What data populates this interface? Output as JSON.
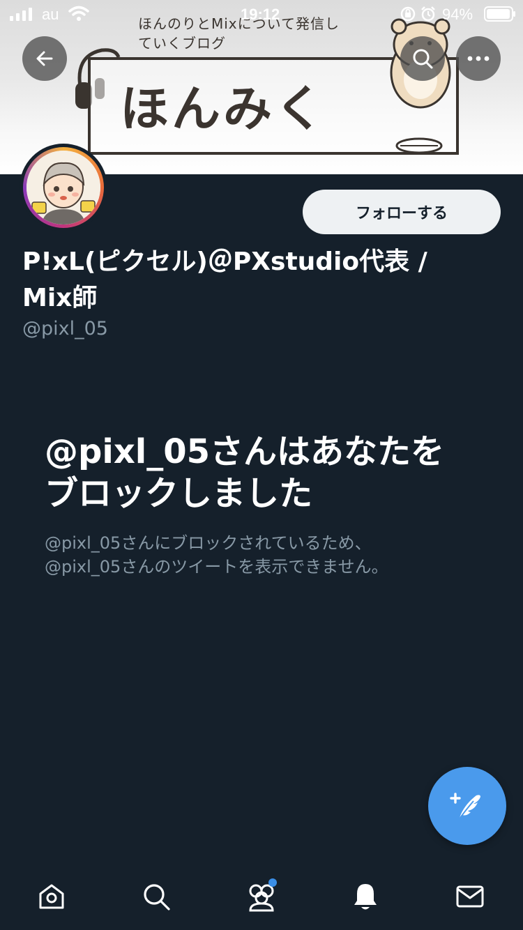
{
  "status_bar": {
    "carrier": "au",
    "time": "19:12",
    "battery_percent": "94%"
  },
  "banner": {
    "tagline": "ほんのりとMixについて発信していくブログ",
    "title": "ほんみく"
  },
  "profile": {
    "display_name": "P!xL(ピクセル)＠PXstudio代表 / Mix師",
    "handle": "@pixl_05",
    "follow_label": "フォローする"
  },
  "blocked": {
    "title": "@pixl_05さんはあなたをブロックしました",
    "line1": "@pixl_05さんにブロックされているため、",
    "line2": "@pixl_05さんのツイートを表示できません。"
  },
  "tab_bar": {
    "items": [
      "home-icon",
      "search-icon",
      "communities-icon",
      "notifications-icon",
      "messages-icon"
    ],
    "communities_has_badge": true
  },
  "colors": {
    "background": "#15202b",
    "accent": "#4a9aec",
    "secondary_text": "#8899a6",
    "follow_button_bg": "#eef1f3"
  }
}
